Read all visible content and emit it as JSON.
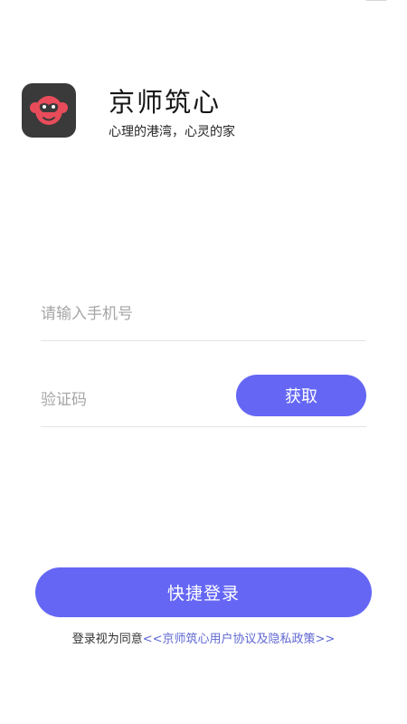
{
  "app": {
    "name": "京师筑心",
    "slogan": "心理的港湾，心灵的家"
  },
  "form": {
    "phone_placeholder": "请输入手机号",
    "code_placeholder": "验证码",
    "get_code_label": "获取",
    "login_label": "快捷登录"
  },
  "agreement": {
    "prefix": "登录视为同意",
    "link_text": "<<京师筑心用户协议及隐私政策>>"
  },
  "colors": {
    "accent": "#6567f4",
    "icon_bg": "#3a3a3a",
    "icon_face": "#e84c5a",
    "link": "#5f67d1"
  }
}
